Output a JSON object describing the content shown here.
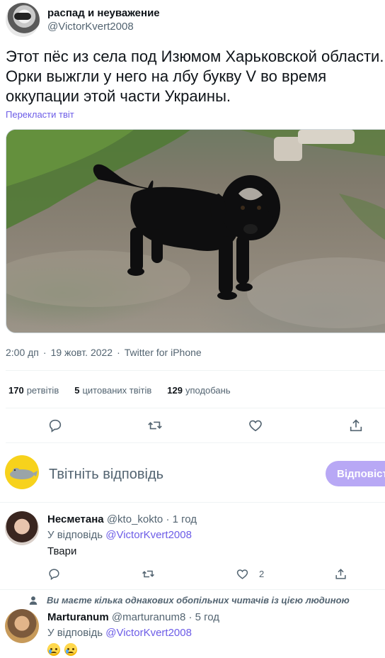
{
  "tweet": {
    "author": {
      "display_name": "распад и неуважение",
      "handle": "@VictorKvert2008"
    },
    "text": "Этот пёс из села под Изюмом Харьковской области.\nОрки выжгли у него на лбу букву V во время\nоккупации этой части Украины.",
    "translate_label": "Перекласти твіт",
    "meta": {
      "time": "2:00 дп",
      "separator": "·",
      "date": "19 жовт. 2022",
      "source": "Twitter for iPhone"
    },
    "stats": {
      "retweets_count": "170",
      "retweets_label": "ретвітів",
      "quotes_count": "5",
      "quotes_label": "цитованих твітів",
      "likes_count": "129",
      "likes_label": "уподобань"
    },
    "actions": {
      "reply_icon": "reply-icon",
      "retweet_icon": "retweet-icon",
      "like_icon": "heart-icon",
      "share_icon": "share-icon"
    }
  },
  "composer": {
    "placeholder": "Твітніть відповідь",
    "reply_button": "Відповісти"
  },
  "replies": [
    {
      "name": "Несметана",
      "handle": "@kto_kokto",
      "separator": "·",
      "time": "1 год",
      "replying_prefix": "У відповідь",
      "replying_to": "@VictorKvert2008",
      "text": "Твари",
      "like_count": "2"
    },
    {
      "social_context": "Ви маєте кілька однакових обопільних читачів із цією людиною",
      "name": "Marturanum",
      "handle": "@marturanum8",
      "separator": "·",
      "time": "5 год",
      "replying_prefix": "У відповідь",
      "replying_to": "@VictorKvert2008"
    }
  ],
  "colors": {
    "accent": "#6c5ce7",
    "muted": "#536471",
    "reply_button_bg": "#b8a8f5",
    "composer_avatar_bg": "#f7d21c"
  }
}
